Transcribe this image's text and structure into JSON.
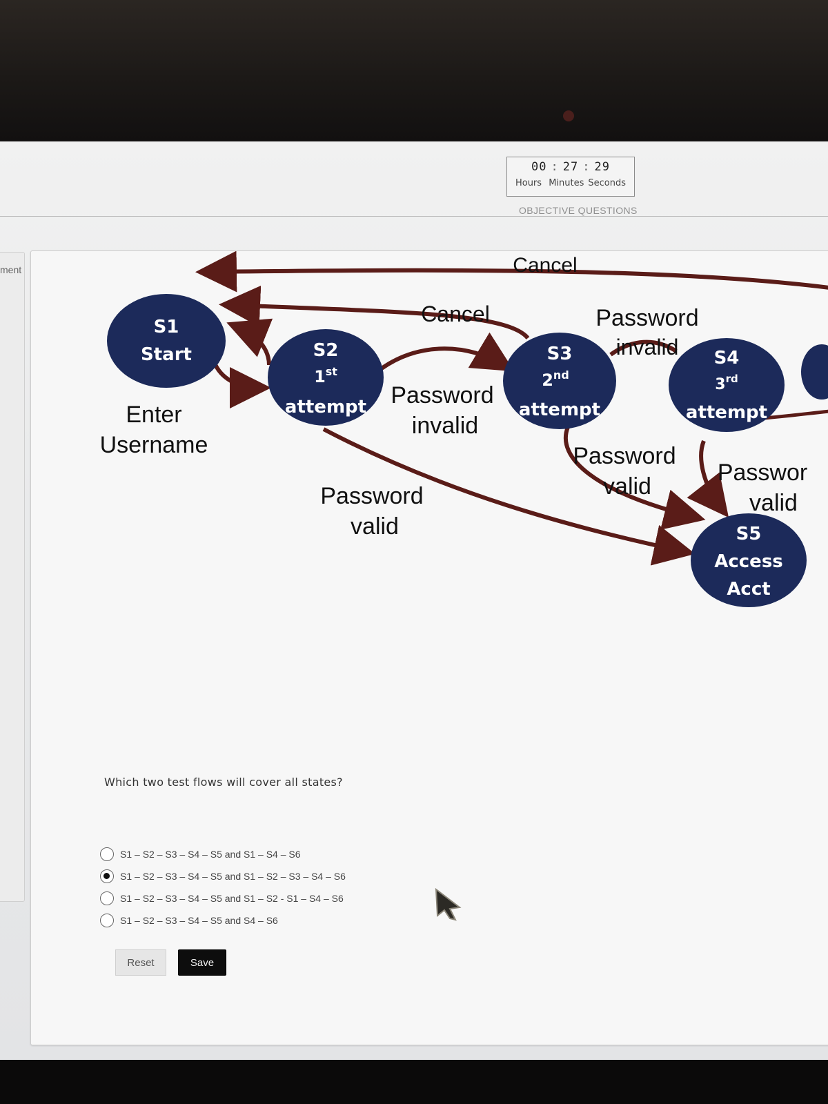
{
  "timer": {
    "hours": "00",
    "minutes": "27",
    "seconds": "29",
    "hours_label": "Hours",
    "minutes_label": "Minutes",
    "seconds_label": "Seconds"
  },
  "section_title": "OBJECTIVE QUESTIONS",
  "side_label": "ment",
  "diagram": {
    "states": {
      "s1": {
        "id": "S1",
        "name": "Start"
      },
      "s2": {
        "id": "S2",
        "ordinal": "1",
        "suffix": "st",
        "name": "attempt"
      },
      "s3": {
        "id": "S3",
        "ordinal": "2",
        "suffix": "nd",
        "name": "attempt"
      },
      "s4": {
        "id": "S4",
        "ordinal": "3",
        "suffix": "rd",
        "name": "attempt"
      },
      "s5": {
        "id": "S5",
        "line1": "Access",
        "line2": "Acct"
      }
    },
    "labels": {
      "enter_1": "Enter",
      "enter_2": "Username",
      "cancel_top": "Cancel",
      "cancel_mid": "Cancel",
      "pw_invalid_a_1": "Password",
      "pw_invalid_a_2": "invalid",
      "pw_invalid_b_1": "Password",
      "pw_invalid_b_2": "invalid",
      "pw_valid_a_1": "Password",
      "pw_valid_a_2": "valid",
      "pw_valid_b_1": "Password",
      "pw_valid_b_2": "valid",
      "pw_valid_c_1": "Passwor",
      "pw_valid_c_2": "valid"
    },
    "colors": {
      "node": "#1c2a5a",
      "arrow": "#5a1c18"
    }
  },
  "question": "Which two test flows will cover all states?",
  "options": [
    {
      "label": "S1 – S2 – S3 – S4 – S5 and S1 – S4 – S6",
      "selected": false
    },
    {
      "label": "S1 – S2 – S3 – S4 – S5 and S1 – S2 – S3 – S4 – S6",
      "selected": true
    },
    {
      "label": "S1 – S2 – S3 – S4 – S5 and S1 – S2 - S1 – S4 – S6",
      "selected": false
    },
    {
      "label": "S1 – S2 – S3 – S4 – S5 and S4 – S6",
      "selected": false
    }
  ],
  "buttons": {
    "reset": "Reset",
    "save": "Save"
  }
}
